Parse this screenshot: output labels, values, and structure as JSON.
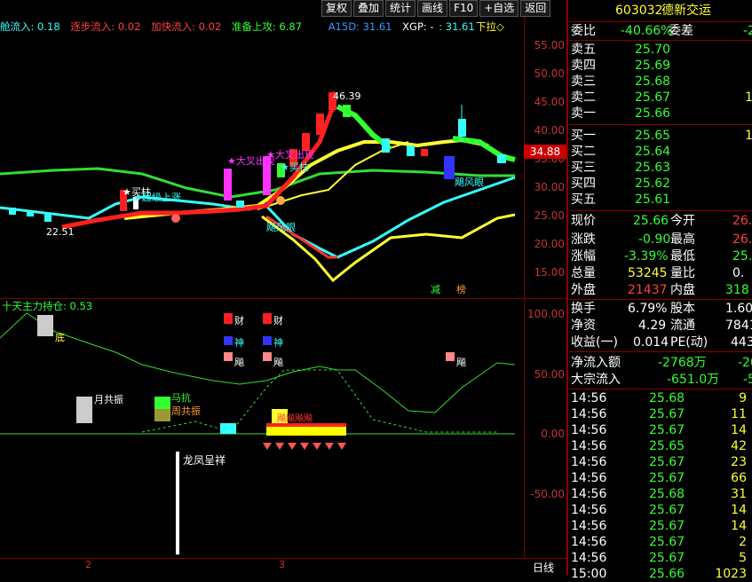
{
  "toolbar": {
    "buttons": [
      "复权",
      "叠加",
      "统计",
      "画线",
      "F10",
      "+自选",
      "返回"
    ]
  },
  "main_legend": [
    {
      "text": "舱流入: 0.18",
      "color": "#33ffff"
    },
    {
      "text": "逐步流入: 0.02",
      "color": "#ff4040"
    },
    {
      "text": "加快流入: 0.02",
      "color": "#ff4040"
    },
    {
      "text": "准备上攻: 6.87",
      "color": "#33ff33"
    },
    {
      "text": "A15D: 31.61",
      "color": "#3399ff"
    },
    {
      "text": "XGP: -",
      "color": "#ffffff"
    },
    {
      "text": ": 31.61",
      "color": "#33ffff"
    }
  ],
  "main_legend_right": "下拉◇",
  "price_axis": [
    "55.00",
    "50.00",
    "45.00",
    "40.00",
    "35.00",
    "30.00",
    "25.00",
    "20.00",
    "15.00"
  ],
  "last_price_tag": "34.88",
  "annotations": {
    "high": "46.39",
    "low": "22.51",
    "cross1": "★大叉出现",
    "cross2": "★大叉出现",
    "buy_col": "★买柱",
    "buy_col2": "★买柱",
    "sc_up": "★超级上涨",
    "wind_eye1": "飓风眼",
    "wind_eye2": "飓风眼",
    "reduce": "减",
    "top_list": "榜"
  },
  "sub_legend": "十天主力持仓: 0.53",
  "sub_axis": [
    "100.00",
    "50.00",
    "0.00",
    "-50.00"
  ],
  "sub_annotations": {
    "di": "底",
    "yue": "月共振",
    "ma": "马抗",
    "zhou": "周共振",
    "cai1": "财",
    "cai2": "财",
    "shen1": "神",
    "shen2": "神",
    "ju1": "飚",
    "ju2": "飚",
    "ju3": "飚",
    "lf": "龙凤呈祥",
    "row_text": "飚飚飚飚"
  },
  "bottom_axis": {
    "d1": "2",
    "d2": "3",
    "period": "日线"
  },
  "quote": {
    "code": "603032",
    "name": "德新交运",
    "weibi_label": "委比",
    "weibi": "-40.66%",
    "weicha_label": "委差",
    "weicha": "-2",
    "sell": [
      {
        "label": "卖五",
        "price": "25.70",
        "vol": ""
      },
      {
        "label": "卖四",
        "price": "25.69",
        "vol": ""
      },
      {
        "label": "卖三",
        "price": "25.68",
        "vol": ""
      },
      {
        "label": "卖二",
        "price": "25.67",
        "vol": "1"
      },
      {
        "label": "卖一",
        "price": "25.66",
        "vol": ""
      }
    ],
    "buy": [
      {
        "label": "买一",
        "price": "25.65",
        "vol": "1"
      },
      {
        "label": "买二",
        "price": "25.64",
        "vol": ""
      },
      {
        "label": "买三",
        "price": "25.63",
        "vol": ""
      },
      {
        "label": "买四",
        "price": "25.62",
        "vol": ""
      },
      {
        "label": "买五",
        "price": "25.61",
        "vol": ""
      }
    ],
    "stats": [
      {
        "l1": "现价",
        "v1": "25.66",
        "c1": "#33ff33",
        "l2": "今开",
        "v2": "26.",
        "c2": "#ff4040"
      },
      {
        "l1": "涨跌",
        "v1": "-0.90",
        "c1": "#33ff33",
        "l2": "最高",
        "v2": "26.",
        "c2": "#ff4040"
      },
      {
        "l1": "涨幅",
        "v1": "-3.39%",
        "c1": "#33ff33",
        "l2": "最低",
        "v2": "25.",
        "c2": "#33ff33"
      },
      {
        "l1": "总量",
        "v1": "53245",
        "c1": "#ffff33",
        "l2": "量比",
        "v2": "0.",
        "c2": "#ffffff"
      },
      {
        "l1": "外盘",
        "v1": "21437",
        "c1": "#ff4040",
        "l2": "内盘",
        "v2": "318",
        "c2": "#33ff33"
      }
    ],
    "stats2": [
      {
        "l1": "换手",
        "v1": "6.79%",
        "c1": "#ffffff",
        "l2": "股本",
        "v2": "1.60"
      },
      {
        "l1": "净资",
        "v1": "4.29",
        "c1": "#ffffff",
        "l2": "流通",
        "v2": "7841"
      },
      {
        "l1": "收益(一)",
        "v1": "0.014",
        "c1": "#ffffff",
        "l2": "PE(动)",
        "v2": "443"
      }
    ],
    "flows": [
      {
        "label": "净流入额",
        "value": "-2768万",
        "extra": "-20"
      },
      {
        "label": "大宗流入",
        "value": "-651.0万",
        "extra": "-5"
      }
    ],
    "ticks": [
      {
        "time": "14:56",
        "price": "25.68",
        "vol": "9",
        "pc": "#33ff33"
      },
      {
        "time": "14:56",
        "price": "25.67",
        "vol": "11",
        "pc": "#33ff33"
      },
      {
        "time": "14:56",
        "price": "25.67",
        "vol": "14",
        "pc": "#33ff33"
      },
      {
        "time": "14:56",
        "price": "25.65",
        "vol": "42",
        "pc": "#33ff33"
      },
      {
        "time": "14:56",
        "price": "25.67",
        "vol": "23",
        "pc": "#33ff33"
      },
      {
        "time": "14:56",
        "price": "25.67",
        "vol": "66",
        "pc": "#33ff33"
      },
      {
        "time": "14:56",
        "price": "25.68",
        "vol": "31",
        "pc": "#33ff33"
      },
      {
        "time": "14:56",
        "price": "25.67",
        "vol": "14",
        "pc": "#33ff33"
      },
      {
        "time": "14:56",
        "price": "25.67",
        "vol": "14",
        "pc": "#33ff33"
      },
      {
        "time": "14:56",
        "price": "25.67",
        "vol": "2",
        "pc": "#33ff33"
      },
      {
        "time": "14:56",
        "price": "25.67",
        "vol": "5",
        "pc": "#33ff33"
      },
      {
        "time": "15:00",
        "price": "25.66",
        "vol": "1023",
        "pc": "#33ff33"
      }
    ]
  }
}
